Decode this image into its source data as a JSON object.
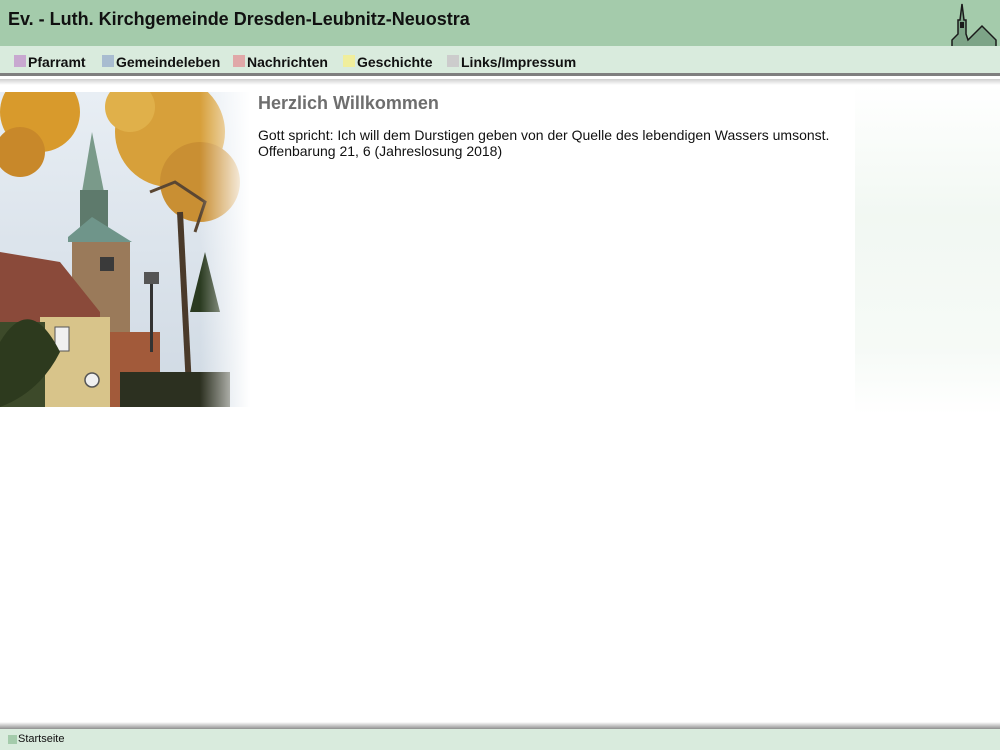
{
  "header": {
    "title": "Ev. - Luth. Kirchgemeinde Dresden-Leubnitz-Neuostra",
    "background": "#a4cbab",
    "logo_icon": "church-icon"
  },
  "nav": {
    "items": [
      {
        "label": "Pfarramt",
        "color": "#c8a8d0"
      },
      {
        "label": "Gemeindeleben",
        "color": "#a8bcd0"
      },
      {
        "label": "Nachrichten",
        "color": "#e0a8a8"
      },
      {
        "label": "Geschichte",
        "color": "#f0ee9c"
      },
      {
        "label": "Links/Impressum",
        "color": "#cccccc"
      }
    ]
  },
  "main": {
    "title": "Herzlich Willkommen",
    "lines": [
      "Gott spricht: Ich will dem Durstigen geben von der Quelle des lebendigen Wassers umsonst.",
      "Offenbarung 21, 6 (Jahreslosung 2018)"
    ]
  },
  "footer": {
    "link_label": "Startseite"
  }
}
